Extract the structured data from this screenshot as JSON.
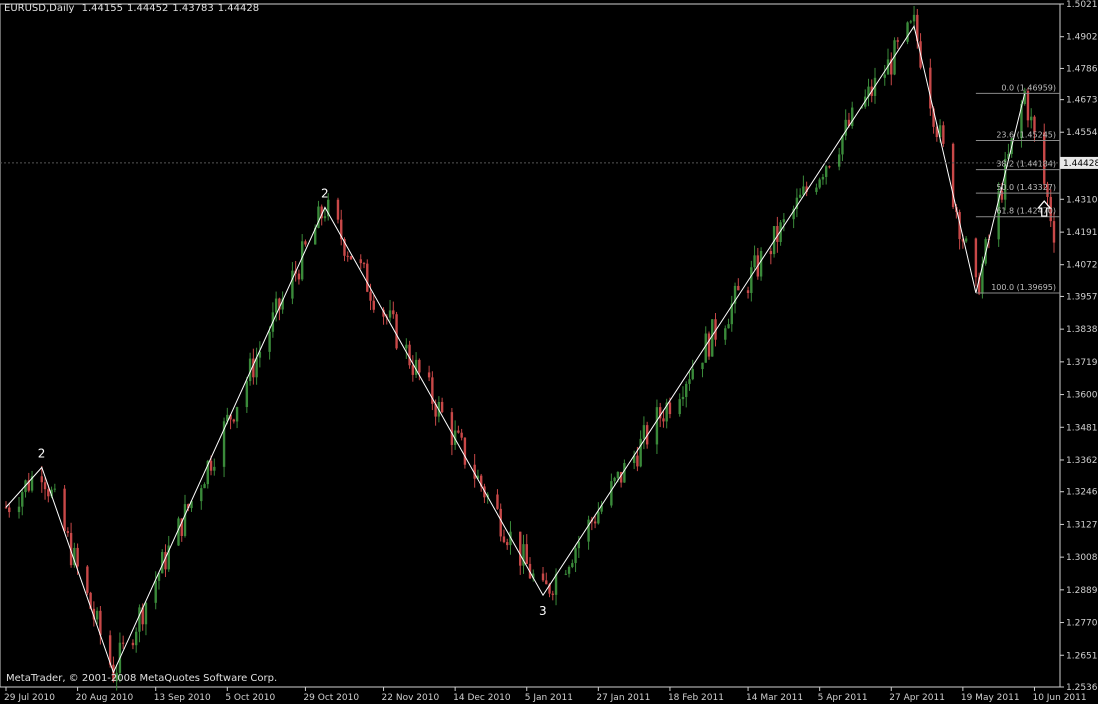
{
  "header": {
    "symbol": "EURUSD,Daily",
    "open": "1.44155",
    "high": "1.44452",
    "low": "1.43783",
    "close": "1.44428"
  },
  "copyright": "MetaTrader, © 2001-2008 MetaQuotes Software Corp.",
  "colors": {
    "background": "#000000",
    "bull": "#3a8a3a",
    "bear": "#c84848",
    "line": "#ffffff",
    "axis": "#cfcfcf",
    "grid": "#333333"
  },
  "chart_data": {
    "type": "candlestick",
    "title": "EURUSD,Daily",
    "y_ticks": [
      "1.50210",
      "1.49020",
      "1.47865",
      "1.46730",
      "1.45545",
      "1.44355",
      "1.43105",
      "1.41910",
      "1.40725",
      "1.39570",
      "1.38380",
      "1.37190",
      "1.36000",
      "1.34810",
      "1.33620",
      "1.32465",
      "1.31275",
      "1.30085",
      "1.28895",
      "1.27705",
      "1.26515",
      "1.25360"
    ],
    "x_ticks": [
      "29 Jul 2010",
      "20 Aug 2010",
      "13 Sep 2010",
      "5 Oct 2010",
      "29 Oct 2010",
      "22 Nov 2010",
      "14 Dec 2010",
      "5 Jan 2011",
      "27 Jan 2011",
      "18 Feb 2011",
      "14 Mar 2011",
      "5 Apr 2011",
      "27 Apr 2011",
      "19 May 2011",
      "10 Jun 2011"
    ],
    "ylim": [
      1.2536,
      1.5021
    ],
    "xlim": [
      "2010-07-29",
      "2011-06-16"
    ],
    "current_price": "1.44428",
    "grid": true,
    "zigzag": [
      {
        "date": "2010-07-29",
        "price": 1.319
      },
      {
        "date": "2010-08-09",
        "price": 1.3335
      },
      {
        "date": "2010-08-31",
        "price": 1.2589
      },
      {
        "date": "2010-11-04",
        "price": 1.4281
      },
      {
        "date": "2011-01-10",
        "price": 1.287
      },
      {
        "date": "2011-05-04",
        "price": 1.494
      },
      {
        "date": "2011-05-23",
        "price": 1.397
      },
      {
        "date": "2011-06-07",
        "price": 1.4696
      }
    ],
    "wave_labels": [
      {
        "text": "2",
        "date": "2010-08-09",
        "price": 1.3335
      },
      {
        "text": "2",
        "date": "2010-11-04",
        "price": 1.4281
      },
      {
        "text": "3",
        "date": "2011-01-10",
        "price": 1.287
      }
    ],
    "fibonacci": {
      "start_date": "2011-05-23",
      "levels": [
        {
          "label": "0.0 (1.46959)",
          "price": 1.46959
        },
        {
          "label": "23.6 (1.45245)",
          "price": 1.45245
        },
        {
          "label": "38.2 (1.44184)",
          "price": 1.44184
        },
        {
          "label": "50.0 (1.43327)",
          "price": 1.43327
        },
        {
          "label": "61.8 (1.42470)",
          "price": 1.4247
        },
        {
          "label": "100.0 (1.39695)",
          "price": 1.39695
        }
      ]
    },
    "arrow": {
      "date": "2011-06-13",
      "price": 1.4304
    }
  }
}
